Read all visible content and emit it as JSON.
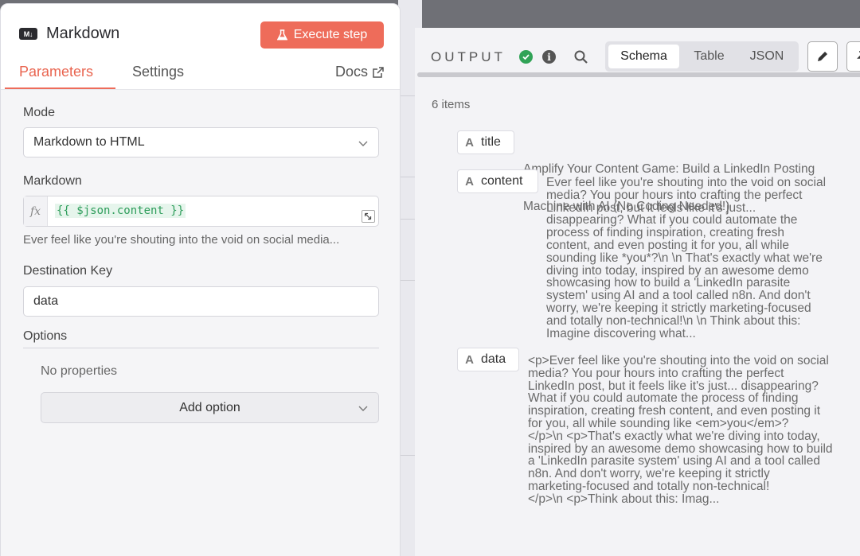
{
  "node": {
    "icon": "markdown-icon",
    "title": "Markdown",
    "execute_label": "Execute step"
  },
  "tabs": [
    {
      "label": "Parameters",
      "active": true
    },
    {
      "label": "Settings",
      "active": false
    }
  ],
  "docs_label": "Docs",
  "parameters": {
    "mode": {
      "label": "Mode",
      "value": "Markdown to HTML"
    },
    "markdown": {
      "label": "Markdown",
      "expression": "{{ $json.content }}",
      "preview": "Ever feel like you're shouting into the void on social media..."
    },
    "destination_key": {
      "label": "Destination Key",
      "value": "data"
    },
    "options": {
      "label": "Options",
      "empty_text": "No properties",
      "add_label": "Add option"
    }
  },
  "output": {
    "title": "OUTPUT",
    "views": [
      {
        "label": "Schema",
        "active": true
      },
      {
        "label": "Table",
        "active": false
      },
      {
        "label": "JSON",
        "active": false
      }
    ],
    "items_count": "6 items",
    "fields": [
      {
        "type": "A",
        "key": "title",
        "lines": [
          "Amplify Your Content Game: Build a LinkedIn Posting",
          "Machine with AI (No Coding Needed!)"
        ]
      },
      {
        "type": "A",
        "key": "content",
        "lines": [
          "Ever feel like you're shouting into the void on social",
          "media? You pour hours into crafting the perfect",
          "LinkedIn post, but it feels like it's just...",
          "disappearing? What if you could automate the",
          "process of finding inspiration, creating fresh",
          "content, and even posting it for you, all while",
          "sounding like *you*?\\n \\n That's exactly what we're",
          "diving into today, inspired by an awesome demo",
          "showcasing how to build a 'LinkedIn parasite",
          "system' using AI and a tool called n8n. And don't",
          "worry, we're keeping it strictly marketing-focused",
          "and totally non-technical!\\n \\n Think about this:",
          "Imagine discovering what..."
        ]
      },
      {
        "type": "A",
        "key": "data",
        "lines": [
          "<p>Ever feel like you're shouting into the void on social",
          "media? You pour hours into crafting the perfect",
          "LinkedIn post, but it feels like it's just... disappearing?",
          "What if you could automate the process of finding",
          "inspiration, creating fresh content, and even posting it",
          "for you, all while sounding like <em>you</em>?",
          "</p>\\n <p>That's exactly what we're diving into today,",
          "inspired by an awesome demo showcasing how to build",
          "a 'LinkedIn parasite system' using AI and a tool called",
          "n8n. And don't worry, we're keeping it strictly",
          "marketing-focused and totally non-technical!",
          "</p>\\n <p>Think about this: Imag..."
        ]
      }
    ]
  },
  "colors": {
    "accent": "#ee6c5a",
    "success": "#31a357",
    "expression": "#2e9d5b"
  }
}
